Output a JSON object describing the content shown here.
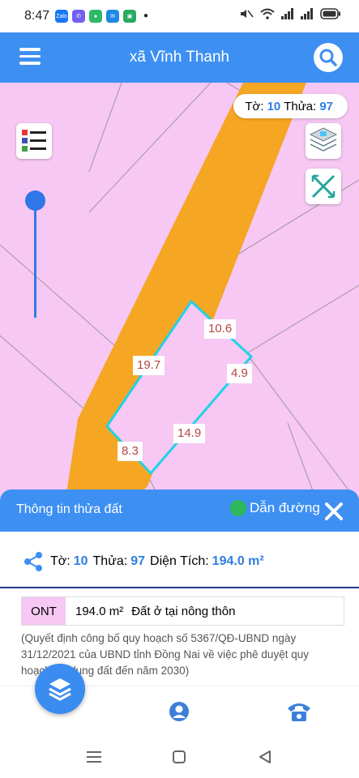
{
  "status_bar": {
    "time": "8:47",
    "apps": [
      {
        "icon": "zalo-icon",
        "label": "Zalo",
        "color": "#1877f2"
      },
      {
        "icon": "viber-icon",
        "label": "",
        "color": "#7360f2"
      },
      {
        "icon": "chat-icon",
        "label": "",
        "color": "#2fb86a"
      },
      {
        "icon": "messenger-icon",
        "label": "",
        "color": "#1e88e5"
      },
      {
        "icon": "app-icon",
        "label": "",
        "color": "#28a960"
      }
    ],
    "icons": [
      "mute-icon",
      "alarm-icon",
      "wifi-icon",
      "signal-icon",
      "signal-icon",
      "battery-icon"
    ]
  },
  "header": {
    "title": "xã Vĩnh Thanh",
    "menu_icon": "menu-icon",
    "search_icon": "search-icon",
    "color": "#3d8ff2"
  },
  "map": {
    "background": "#f6c8f3",
    "road_color": "#f5a623",
    "highlight_color": "#1fd3e6",
    "sheet_label": "Tờ:",
    "sheet_value": "10",
    "parcel_label": "Thửa:",
    "parcel_value": "97",
    "dimensions": [
      "10.6",
      "19.7",
      "4.9",
      "14.9",
      "8.3"
    ]
  },
  "info_panel": {
    "title": "Thông tin thửa đất",
    "directions_label": "Dẫn đường",
    "sheet_label": "Tờ:",
    "sheet_value": "10",
    "parcel_label": "Thửa:",
    "parcel_value": "97",
    "area_label": "Diện Tích:",
    "area_value": "194.0 m²",
    "land_use": {
      "code": "ONT",
      "area": "194.0 m²",
      "description": "Đất ở tại nông thôn"
    },
    "note": "(Quyết định công bố quy hoạch số 5367/QĐ-UBND ngày 31/12/2021 của UBND tỉnh Đồng Nai về việc phê duyệt quy hoạch sử dụng đất đến năm 2030)"
  },
  "bottom_nav": {
    "items": [
      "layers-icon",
      "user-icon",
      "phone-icon"
    ]
  },
  "system_nav": [
    "recents-icon",
    "home-icon",
    "back-icon"
  ]
}
